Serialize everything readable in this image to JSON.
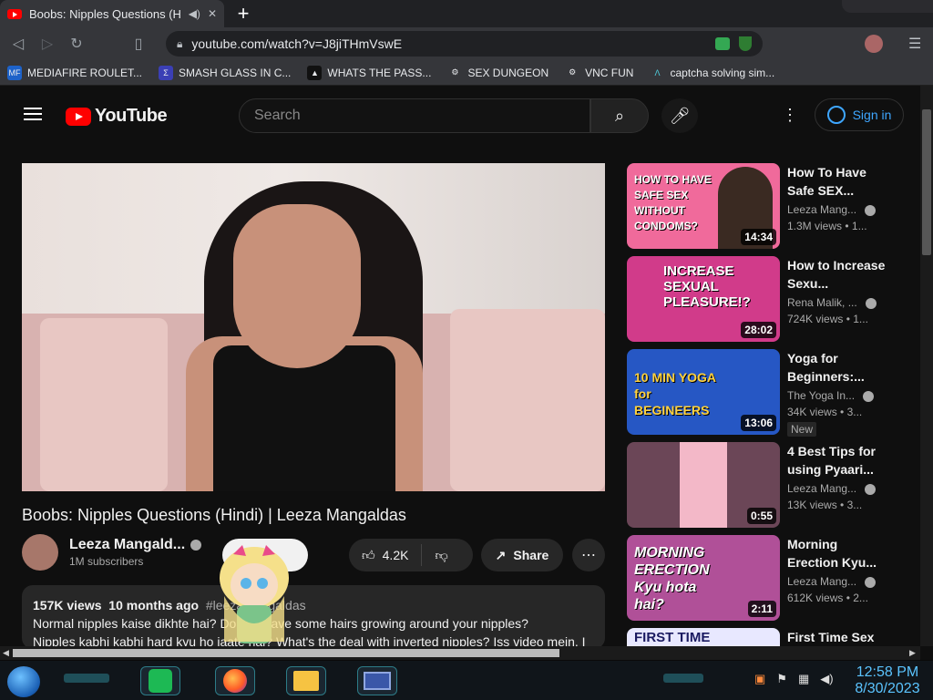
{
  "browser": {
    "tab_title": "Boobs: Nipples Questions (Hin",
    "url": "youtube.com/watch?v=J8jiTHmVswE",
    "new_tab": "+",
    "close": "✕",
    "bookmarks": [
      {
        "icon": "MF",
        "label": "MEDIAFIRE ROULET..."
      },
      {
        "icon": "Σ",
        "label": "SMASH GLASS IN C..."
      },
      {
        "icon": "▲",
        "label": "WHATS THE PASS..."
      },
      {
        "icon": "⚙",
        "label": "SEX DUNGEON"
      },
      {
        "icon": "⚙",
        "label": "VNC FUN"
      },
      {
        "icon": "Λ",
        "label": "captcha solving sim..."
      }
    ]
  },
  "youtube": {
    "logo": "YouTube",
    "search_placeholder": "Search",
    "signin": "Sign in",
    "video": {
      "title": "Boobs: Nipples Questions (Hindi) | Leeza Mangaldas",
      "channel": "Leeza Mangald...",
      "subscribers": "1M subscribers",
      "likes": "4.2K",
      "share": "Share",
      "views": "157K views",
      "age": "10 months ago",
      "hashtag": "#leezamangaldas",
      "desc_line1": "Normal nipples kaise dikhte hai? Do you have some hairs growing around your nipples?",
      "desc_line2": "Nipples kabhi kabhi hard kyu ho jaate hai? What's the deal with inverted nipples? Iss video mein, I"
    },
    "recommended": [
      {
        "title": "How To Have Safe SEX...",
        "channel": "Leeza Mang...",
        "views": "1.3M views",
        "age": "• 1...",
        "duration": "14:34",
        "thumb_text": "HOW TO HAVE SAFE SEX WITHOUT CONDOMS?",
        "color": "#f06a9b",
        "new": ""
      },
      {
        "title": "How to Increase Sexu...",
        "channel": "Rena Malik, ...",
        "views": "724K views",
        "age": "• 1...",
        "duration": "28:02",
        "thumb_text": "INCREASE SEXUAL PLEASURE!?",
        "color": "#d13b8a",
        "new": ""
      },
      {
        "title": "Yoga for Beginners:...",
        "channel": "The Yoga In...",
        "views": "34K views",
        "age": "• 3...",
        "duration": "13:06",
        "thumb_text": "10 MIN YOGA for BEGINEERS",
        "color": "#2657c4",
        "new": "New"
      },
      {
        "title": "4 Best Tips for using Pyaari...",
        "channel": "Leeza Mang...",
        "views": "13K views",
        "age": "• 3...",
        "duration": "0:55",
        "thumb_text": "",
        "color": "#6b4657",
        "new": ""
      },
      {
        "title": "Morning Erection Kyu...",
        "channel": "Leeza Mang...",
        "views": "612K views",
        "age": "• 2...",
        "duration": "2:11",
        "thumb_text": "MORNING ERECTION Kyu hota hai?",
        "color": "#b05098",
        "new": ""
      },
      {
        "title": "First Time Sex",
        "channel": "",
        "views": "",
        "age": "",
        "duration": "",
        "thumb_text": "FIRST TIME",
        "color": "#e8e8ff",
        "new": ""
      }
    ]
  },
  "taskbar": {
    "time": "12:58 PM",
    "date": "8/30/2023"
  }
}
